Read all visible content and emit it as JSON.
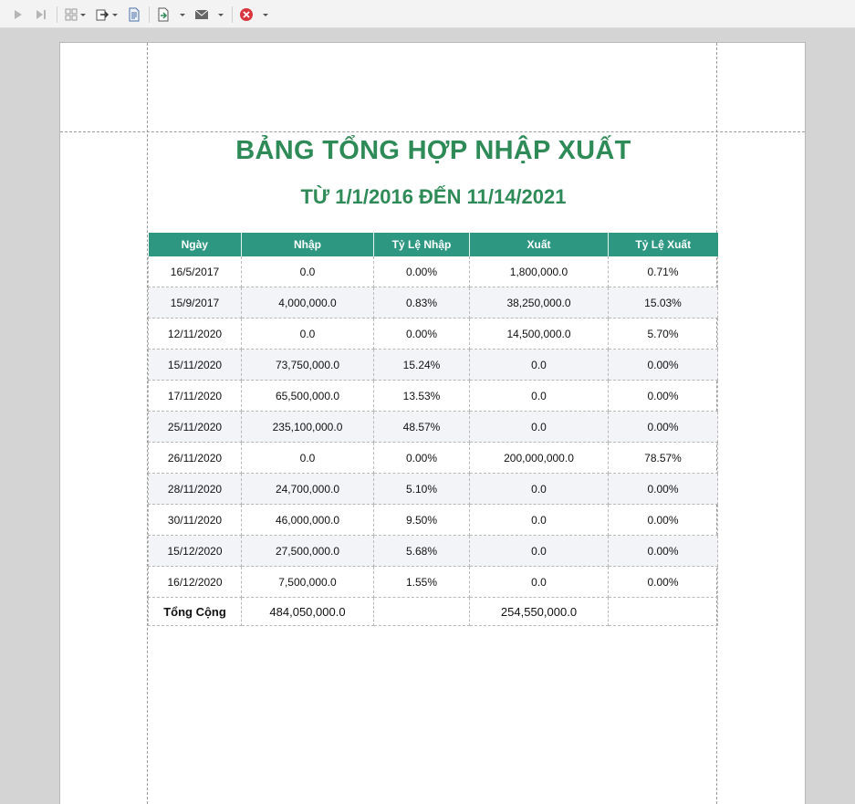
{
  "toolbar": {
    "icons": [
      "play-icon",
      "skip-to-end-icon",
      "layout-icon",
      "export-icon",
      "document-icon",
      "import-icon",
      "mail-icon",
      "close-icon"
    ]
  },
  "report": {
    "title": "BẢNG TỔNG HỢP NHẬP XUẤT",
    "subtitle": "TỪ 1/1/2016 ĐẾN 11/14/2021",
    "columns": [
      "Ngày",
      "Nhập",
      "Tỷ Lệ Nhập",
      "Xuất",
      "Tỷ Lệ Xuất"
    ],
    "rows": [
      [
        "16/5/2017",
        "0.0",
        "0.00%",
        "1,800,000.0",
        "0.71%"
      ],
      [
        "15/9/2017",
        "4,000,000.0",
        "0.83%",
        "38,250,000.0",
        "15.03%"
      ],
      [
        "12/11/2020",
        "0.0",
        "0.00%",
        "14,500,000.0",
        "5.70%"
      ],
      [
        "15/11/2020",
        "73,750,000.0",
        "15.24%",
        "0.0",
        "0.00%"
      ],
      [
        "17/11/2020",
        "65,500,000.0",
        "13.53%",
        "0.0",
        "0.00%"
      ],
      [
        "25/11/2020",
        "235,100,000.0",
        "48.57%",
        "0.0",
        "0.00%"
      ],
      [
        "26/11/2020",
        "0.0",
        "0.00%",
        "200,000,000.0",
        "78.57%"
      ],
      [
        "28/11/2020",
        "24,700,000.0",
        "5.10%",
        "0.0",
        "0.00%"
      ],
      [
        "30/11/2020",
        "46,000,000.0",
        "9.50%",
        "0.0",
        "0.00%"
      ],
      [
        "15/12/2020",
        "27,500,000.0",
        "5.68%",
        "0.0",
        "0.00%"
      ],
      [
        "16/12/2020",
        "7,500,000.0",
        "1.55%",
        "0.0",
        "0.00%"
      ]
    ],
    "total": {
      "label": "Tổng Cộng",
      "nhap": "484,050,000.0",
      "ty_le_nhap": "",
      "xuat": "254,550,000.0",
      "ty_le_xuat": ""
    }
  },
  "colors": {
    "title": "#2e8b57",
    "header_bg": "#2e9782",
    "stripe": "#f3f4f8"
  }
}
